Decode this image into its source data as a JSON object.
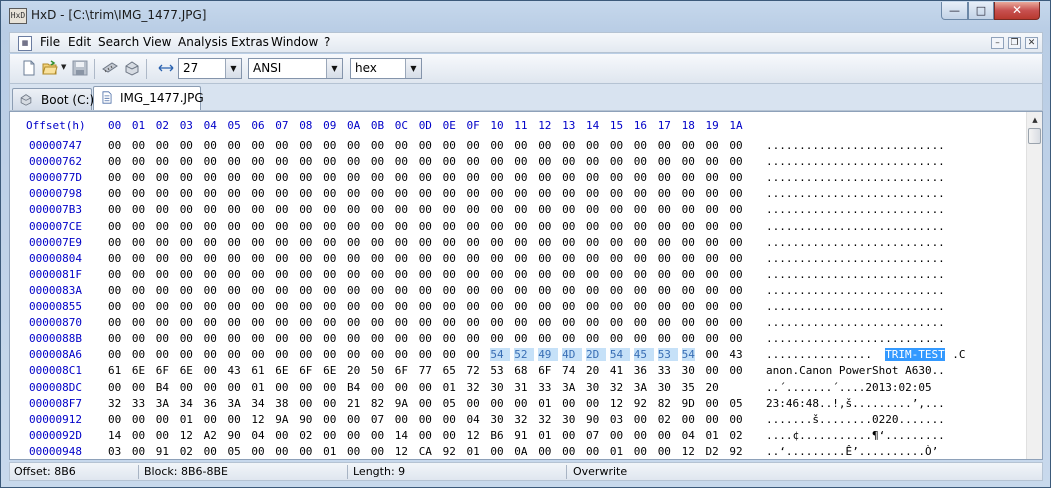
{
  "window": {
    "app_icon_text": "HxD",
    "title": "HxD - [C:\\trim\\IMG_1477.JPG]",
    "min_glyph": "—",
    "max_glyph": "□",
    "close_glyph": "✕"
  },
  "menu": {
    "items": [
      "File",
      "Edit",
      "Search",
      "View",
      "Analysis",
      "Extras",
      "Window",
      "?"
    ],
    "mdi_min": "–",
    "mdi_restore": "❐",
    "mdi_close": "✕"
  },
  "toolbar": {
    "bytes_per_row": "27",
    "charset": "ANSI",
    "offset_base": "hex",
    "dropdown_glyph": "▼",
    "icons": [
      "new-file-icon",
      "open-file-icon",
      "save-icon",
      "ram-icon",
      "disk-icon",
      "bytes-per-row-icon"
    ]
  },
  "tabs": [
    {
      "label": "Boot (C:)",
      "icon": "disk-icon",
      "active": false
    },
    {
      "label": "IMG_1477.JPG",
      "icon": "document-icon",
      "active": true
    }
  ],
  "hex": {
    "header_offset": "Offset(h)",
    "columns": [
      "00",
      "01",
      "02",
      "03",
      "04",
      "05",
      "06",
      "07",
      "08",
      "09",
      "0A",
      "0B",
      "0C",
      "0D",
      "0E",
      "0F",
      "10",
      "11",
      "12",
      "13",
      "14",
      "15",
      "16",
      "17",
      "18",
      "19",
      "1A"
    ],
    "rows": [
      {
        "offset": "00000747",
        "bytes": "00 00 00 00 00 00 00 00 00 00 00 00 00 00 00 00 00 00 00 00 00 00 00 00 00 00 00",
        "text": "..........................."
      },
      {
        "offset": "00000762",
        "bytes": "00 00 00 00 00 00 00 00 00 00 00 00 00 00 00 00 00 00 00 00 00 00 00 00 00 00 00",
        "text": "..........................."
      },
      {
        "offset": "0000077D",
        "bytes": "00 00 00 00 00 00 00 00 00 00 00 00 00 00 00 00 00 00 00 00 00 00 00 00 00 00 00",
        "text": "..........................."
      },
      {
        "offset": "00000798",
        "bytes": "00 00 00 00 00 00 00 00 00 00 00 00 00 00 00 00 00 00 00 00 00 00 00 00 00 00 00",
        "text": "..........................."
      },
      {
        "offset": "000007B3",
        "bytes": "00 00 00 00 00 00 00 00 00 00 00 00 00 00 00 00 00 00 00 00 00 00 00 00 00 00 00",
        "text": "..........................."
      },
      {
        "offset": "000007CE",
        "bytes": "00 00 00 00 00 00 00 00 00 00 00 00 00 00 00 00 00 00 00 00 00 00 00 00 00 00 00",
        "text": "..........................."
      },
      {
        "offset": "000007E9",
        "bytes": "00 00 00 00 00 00 00 00 00 00 00 00 00 00 00 00 00 00 00 00 00 00 00 00 00 00 00",
        "text": "..........................."
      },
      {
        "offset": "00000804",
        "bytes": "00 00 00 00 00 00 00 00 00 00 00 00 00 00 00 00 00 00 00 00 00 00 00 00 00 00 00",
        "text": "..........................."
      },
      {
        "offset": "0000081F",
        "bytes": "00 00 00 00 00 00 00 00 00 00 00 00 00 00 00 00 00 00 00 00 00 00 00 00 00 00 00",
        "text": "..........................."
      },
      {
        "offset": "0000083A",
        "bytes": "00 00 00 00 00 00 00 00 00 00 00 00 00 00 00 00 00 00 00 00 00 00 00 00 00 00 00",
        "text": "..........................."
      },
      {
        "offset": "00000855",
        "bytes": "00 00 00 00 00 00 00 00 00 00 00 00 00 00 00 00 00 00 00 00 00 00 00 00 00 00 00",
        "text": "..........................."
      },
      {
        "offset": "00000870",
        "bytes": "00 00 00 00 00 00 00 00 00 00 00 00 00 00 00 00 00 00 00 00 00 00 00 00 00 00 00",
        "text": "..........................."
      },
      {
        "offset": "0000088B",
        "bytes": "00 00 00 00 00 00 00 00 00 00 00 00 00 00 00 00 00 00 00 00 00 00 00 00 00 00 00",
        "text": "..........................."
      },
      {
        "offset": "000008A6",
        "bytes": "00 00 00 00 00 00 00 00 00 00 00 00 00 00 00 00 54 52 49 4D 2D 54 45 53 54 00 43",
        "text": "................TRIM-TEST.C",
        "sel_start": 16,
        "sel_len": 9
      },
      {
        "offset": "000008C1",
        "bytes": "61 6E 6F 6E 00 43 61 6E 6F 6E 20 50 6F 77 65 72 53 68 6F 74 20 41 36 33 30 00 00",
        "text": "anon.Canon PowerShot A630.."
      },
      {
        "offset": "000008DC",
        "bytes": "00 00 B4 00 00 00 01 00 00 00 B4 00 00 00 01 32 30 31 33 3A 30 32 3A 30 35 20",
        "text": "..´.......´....2013:02:05 "
      },
      {
        "offset": "000008F7",
        "bytes": "32 33 3A 34 36 3A 34 38 00 00 21 82 9A 00 05 00 00 00 01 00 00 12 92 82 9D 00 05",
        "text": "23:46:48..!‚š.........’‚..."
      },
      {
        "offset": "00000912",
        "bytes": "00 00 00 01 00 00 12 9A 90 00 00 07 00 00 00 04 30 32 32 30 90 03 00 02 00 00 00",
        "text": ".......š........0220......."
      },
      {
        "offset": "0000092D",
        "bytes": "14 00 00 12 A2 90 04 00 02 00 00 00 14 00 00 12 B6 91 01 00 07 00 00 00 04 01 02",
        "text": "....¢...........¶‘........."
      },
      {
        "offset": "00000948",
        "bytes": "03 00 91 02 00 05 00 00 00 01 00 00 12 CA 92 01 00 0A 00 00 00 01 00 00 12 D2 92",
        "text": "..‘.........Ê’..........Ò’"
      }
    ]
  },
  "status": {
    "offset": "Offset: 8B6",
    "block": "Block: 8B6-8BE",
    "length": "Length: 9",
    "mode": "Overwrite"
  }
}
